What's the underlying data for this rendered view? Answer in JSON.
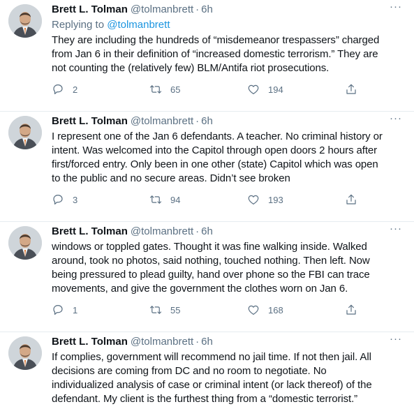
{
  "tweets": [
    {
      "name": "Brett L. Tolman",
      "handle": "@tolmanbrett",
      "time": "6h",
      "replying_prefix": "Replying to ",
      "replying_to": "@tolmanbrett",
      "lines": [
        "They are including the hundreds of “misdemeanor trespassers” charged",
        "from Jan 6 in their definition of “increased domestic terrorism.”  They are",
        "not counting the (relatively few) BLM/Antifa riot prosecutions."
      ],
      "replies": "2",
      "retweets": "65",
      "likes": "194"
    },
    {
      "name": "Brett L. Tolman",
      "handle": "@tolmanbrett",
      "time": "6h",
      "lines": [
        "I represent one of the Jan 6 defendants. A teacher. No criminal history or",
        "intent. Was welcomed into the Capitol through open doors 2 hours after",
        "first/forced entry.  Only been in one other (state) Capitol which was open",
        "to the public and no secure areas. Didn’t see broken"
      ],
      "replies": "3",
      "retweets": "94",
      "likes": "193"
    },
    {
      "name": "Brett L. Tolman",
      "handle": "@tolmanbrett",
      "time": "6h",
      "lines": [
        "windows or toppled gates.  Thought it was fine walking inside. Walked",
        "around, took no photos, said nothing, touched nothing. Then left. Now",
        "being pressured to plead guilty, hand over phone so the FBI can trace",
        "movements, and give the government the clothes worn on Jan 6."
      ],
      "replies": "1",
      "retweets": "55",
      "likes": "168"
    },
    {
      "name": "Brett L. Tolman",
      "handle": "@tolmanbrett",
      "time": "6h",
      "lines": [
        "If complies, government will recommend no jail time. If not then jail. All",
        "decisions are coming from DC and no room to negotiate. No",
        "individualized analysis of case or criminal intent (or lack thereof) of the",
        "defendant. My client is the furthest thing from a “domestic terrorist.”"
      ]
    }
  ],
  "common": {
    "separator": "·",
    "more_glyph": "···"
  },
  "colors": {
    "text": "#0f1419",
    "secondary": "#5b7083",
    "link": "#1b95e0",
    "divider": "#e6ecf0"
  },
  "icons": {
    "reply": "reply-icon",
    "retweet": "retweet-icon",
    "like": "like-icon",
    "share": "share-icon",
    "more": "more-icon"
  }
}
